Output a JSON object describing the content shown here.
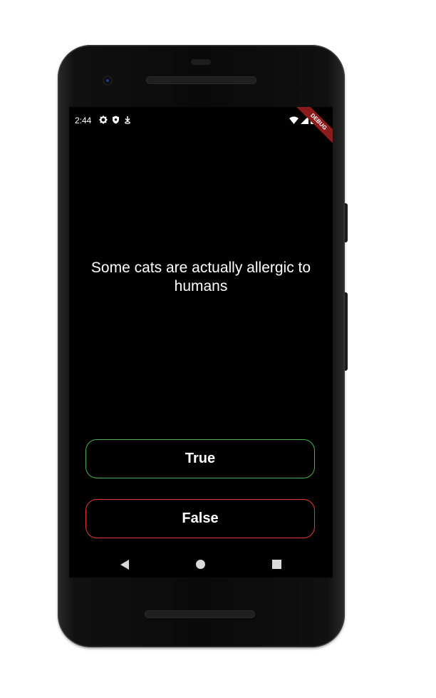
{
  "status_bar": {
    "time": "2:44",
    "left_icons": [
      "gear-icon",
      "shield-icon",
      "download-icon"
    ],
    "right_icons": [
      "wifi-icon",
      "signal-icon",
      "battery-icon"
    ]
  },
  "debug_banner": "DEBUG",
  "quiz": {
    "question": "Some cats are actually allergic to humans",
    "true_label": "True",
    "false_label": "False"
  },
  "colors": {
    "background": "#000000",
    "true_border": "#4caf50",
    "false_border": "#e53935",
    "banner": "#8a1c1c"
  },
  "navigation": [
    "back-icon",
    "home-icon",
    "recents-icon"
  ]
}
